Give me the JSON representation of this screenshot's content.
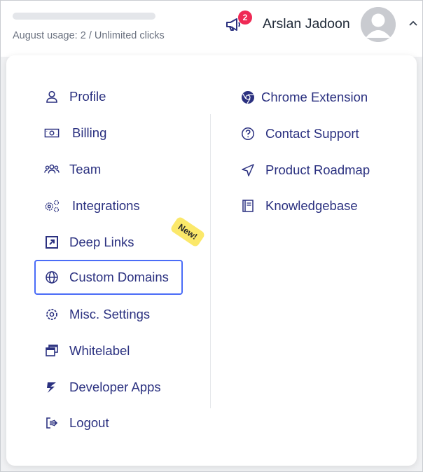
{
  "header": {
    "usage_text": "August usage: 2 / Unlimited clicks",
    "notification_count": "2",
    "user_name": "Arslan Jadoon"
  },
  "menu": {
    "left": [
      {
        "id": "profile",
        "label": "Profile",
        "icon": "user-icon"
      },
      {
        "id": "billing",
        "label": "Billing",
        "icon": "banknote-icon"
      },
      {
        "id": "team",
        "label": "Team",
        "icon": "team-icon"
      },
      {
        "id": "integrations",
        "label": "Integrations",
        "icon": "gears-icon"
      },
      {
        "id": "deep-links",
        "label": "Deep Links",
        "icon": "external-link-icon"
      },
      {
        "id": "custom-domains",
        "label": "Custom Domains",
        "icon": "globe-icon"
      },
      {
        "id": "misc-settings",
        "label": "Misc. Settings",
        "icon": "gear-icon"
      },
      {
        "id": "whitelabel",
        "label": "Whitelabel",
        "icon": "windows-icon"
      },
      {
        "id": "developer-apps",
        "label": "Developer Apps",
        "icon": "devapps-icon"
      },
      {
        "id": "logout",
        "label": "Logout",
        "icon": "logout-icon"
      }
    ],
    "right": [
      {
        "id": "chrome-extension",
        "label": "Chrome Extension",
        "icon": "chrome-icon"
      },
      {
        "id": "contact-support",
        "label": "Contact Support",
        "icon": "help-circle-icon"
      },
      {
        "id": "product-roadmap",
        "label": "Product Roadmap",
        "icon": "navigation-icon"
      },
      {
        "id": "knowledgebase",
        "label": "Knowledgebase",
        "icon": "book-icon"
      }
    ],
    "new_badge": "New!"
  },
  "colors": {
    "menu_text": "#2b3180",
    "badge": "#ef2a55",
    "active_outline": "#4a6cf7",
    "new_tag": "#fbe86a"
  }
}
